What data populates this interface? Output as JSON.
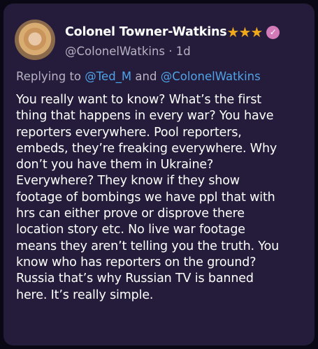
{
  "post": {
    "author": {
      "display_name": "Colonel Towner-Watkins",
      "handle": "@ColonelWatkins",
      "time_ago": "1d",
      "separator": "·",
      "badge_stars": [
        "★",
        "★",
        "★"
      ],
      "verified_icon": "✓"
    },
    "reply": {
      "prefix": "Replying to",
      "mention_1": "@Ted_M",
      "conjunction": "and",
      "mention_2": "@ColonelWatkins"
    },
    "body_lines": [
      "You really want to know? What’s the first",
      "thing that happens in every war? You have",
      "reporters everywhere. Pool reporters,",
      "embeds, they’re freaking everywhere. Why",
      "don’t you have them in Ukraine?",
      "Everywhere? They know if they show",
      "footage of bombings we have ppl that with",
      "hrs can either prove or disprove there",
      "location story etc. No live war footage",
      "means they aren’t telling you the truth. You",
      "know who has reporters on the ground?",
      "Russia that’s why Russian TV is banned",
      "here. It’s really simple."
    ]
  },
  "colors": {
    "card_background": "#241c3a",
    "star": "#f0a91a",
    "verified_badge": "#d37ab8",
    "mention": "#4fa3e8",
    "muted_text": "#b7b2c4"
  }
}
